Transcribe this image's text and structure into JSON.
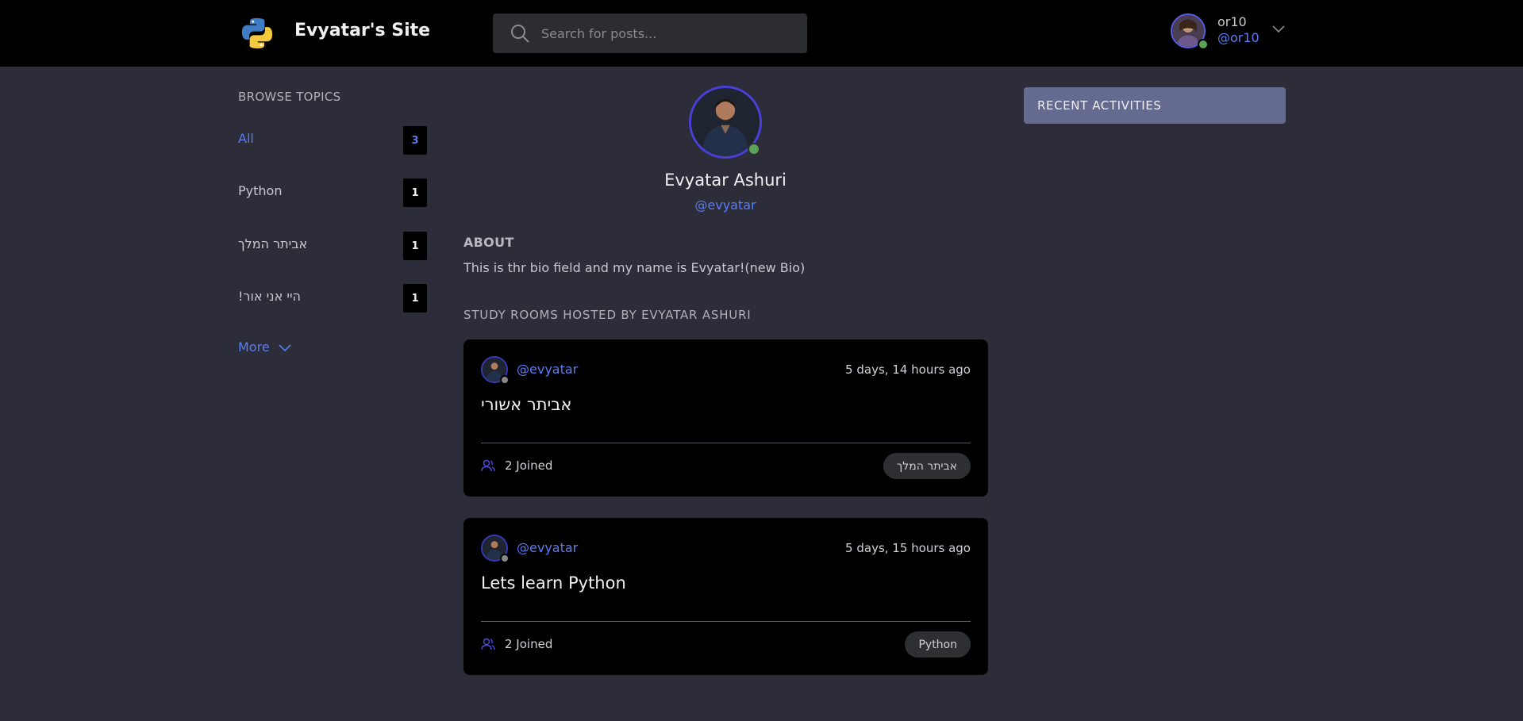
{
  "header": {
    "site_title": "Evyatar's Site",
    "search_placeholder": "Search for posts...",
    "user": {
      "name": "or10",
      "handle": "@or10"
    }
  },
  "sidebar": {
    "title": "BROWSE TOPICS",
    "topics": [
      {
        "label": "All",
        "count": "3",
        "active": true
      },
      {
        "label": "Python",
        "count": "1"
      },
      {
        "label": "אביתר המלך",
        "count": "1"
      },
      {
        "label": "!היי אני אור",
        "count": "1"
      }
    ],
    "more_label": "More"
  },
  "profile": {
    "name": "Evyatar Ashuri",
    "handle": "@evyatar",
    "about_title": "ABOUT",
    "about_text": "This is thr bio field and my name is Evyatar!(new Bio)",
    "rooms_title": "STUDY ROOMS HOSTED BY EVYATAR ASHURI"
  },
  "rooms": [
    {
      "host": "@evyatar",
      "time": "5 days, 14 hours ago",
      "title": "אביתר אשורי",
      "joined": "2 Joined",
      "topic": "אביתר המלך"
    },
    {
      "host": "@evyatar",
      "time": "5 days, 15 hours ago",
      "title": "Lets learn Python",
      "joined": "2 Joined",
      "topic": "Python"
    }
  ],
  "recent": {
    "title": "RECENT ACTIVITIES"
  },
  "colors": {
    "accent": "#5a7cf5",
    "background": "#2d2d39",
    "header": "#000000",
    "recent_bar": "#656a91",
    "online": "#5aa45a"
  },
  "icons": [
    "python-logo",
    "search-icon",
    "chevron-down-icon",
    "user-group-icon"
  ]
}
